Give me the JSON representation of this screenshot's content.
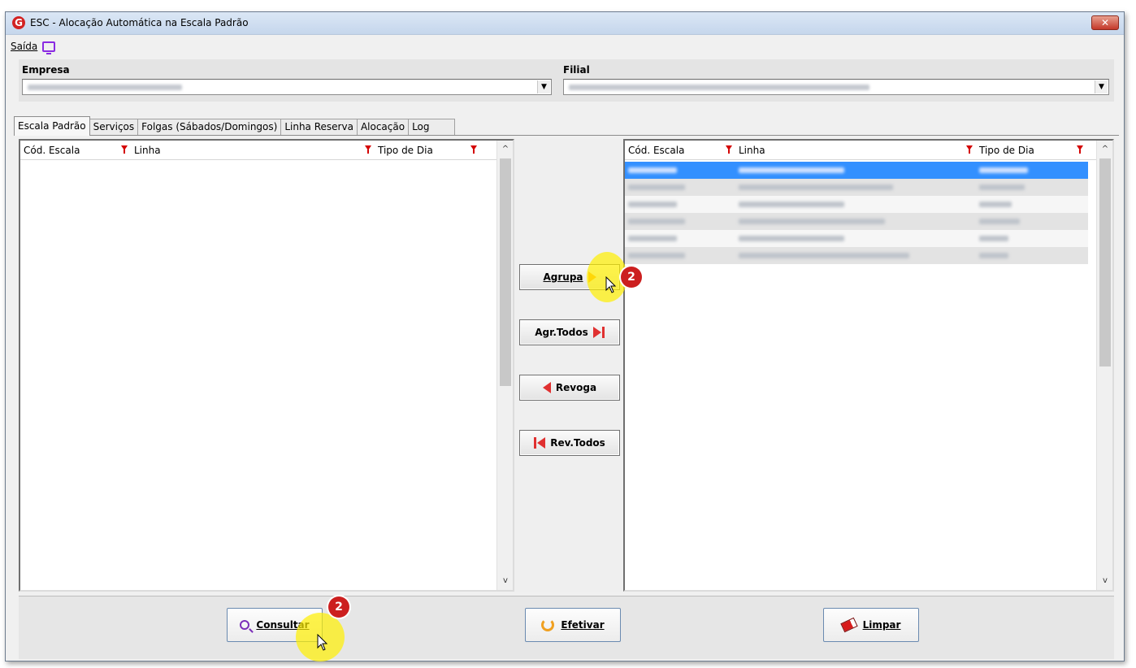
{
  "window": {
    "title": "ESC - Alocação Automática na Escala Padrão",
    "app_icon": "G",
    "close_label": "✕"
  },
  "menu": {
    "exit_label": "Saída",
    "monitor_icon": "monitor-icon"
  },
  "filters": {
    "company_label": "Empresa",
    "branch_label": "Filial"
  },
  "tabs": [
    {
      "label": "Escala Padrão",
      "active": true
    },
    {
      "label": "Serviços",
      "active": false
    },
    {
      "label": "Folgas (Sábados/Domingos)",
      "active": false
    },
    {
      "label": "Linha Reserva",
      "active": false
    },
    {
      "label": "Alocação",
      "active": false
    },
    {
      "label": "Log",
      "active": false
    }
  ],
  "left_grid": {
    "columns": [
      "Cód. Escala",
      "Linha",
      "Tipo de Dia"
    ]
  },
  "right_grid": {
    "columns": [
      "Cód. Escala",
      "Linha",
      "Tipo de Dia"
    ]
  },
  "middle_buttons": {
    "agrupa": "Agrupa",
    "agr_todos": "Agr.Todos",
    "revoga": "Revoga",
    "rev_todos": "Rev.Todos"
  },
  "bottom_buttons": {
    "consultar": "Consultar",
    "efetivar": "Efetivar",
    "limpar": "Limpar"
  },
  "annotations": {
    "badge_1": "2",
    "badge_2": "2"
  },
  "colors": {
    "selection": "#3390ff",
    "filter_icon": "#d40000",
    "badge": "#cc1f1f",
    "highlight": "#fff000"
  }
}
